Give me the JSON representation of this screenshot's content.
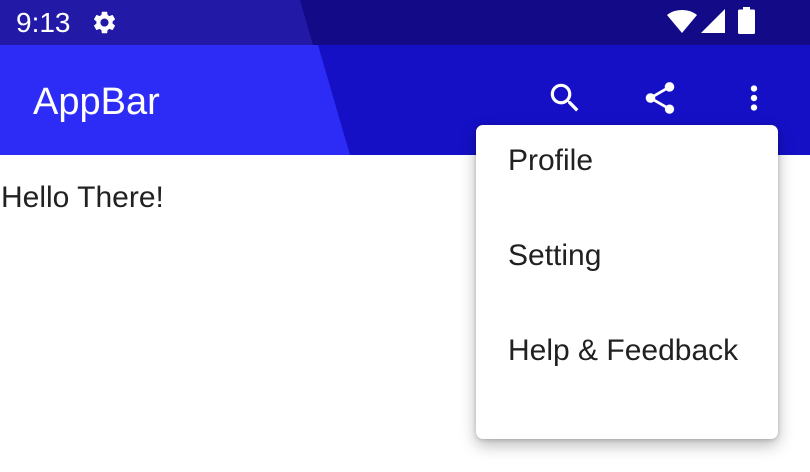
{
  "status_bar": {
    "time": "9:13",
    "icons": [
      "gear-icon",
      "wifi-icon",
      "cell-signal-icon",
      "battery-icon"
    ]
  },
  "app_bar": {
    "title": "AppBar",
    "actions": [
      "search-icon",
      "share-icon",
      "more-vert-icon"
    ]
  },
  "body": {
    "text": "Hello There!"
  },
  "menu": {
    "items": [
      {
        "label": "Profile"
      },
      {
        "label": "Setting"
      },
      {
        "label": "Help & Feedback"
      }
    ]
  },
  "colors": {
    "status_bar": "#120a86",
    "app_bar": "#1510c6",
    "app_bar_accent": "#2d2cf6",
    "on_primary": "#ffffff",
    "text": "#212121"
  }
}
